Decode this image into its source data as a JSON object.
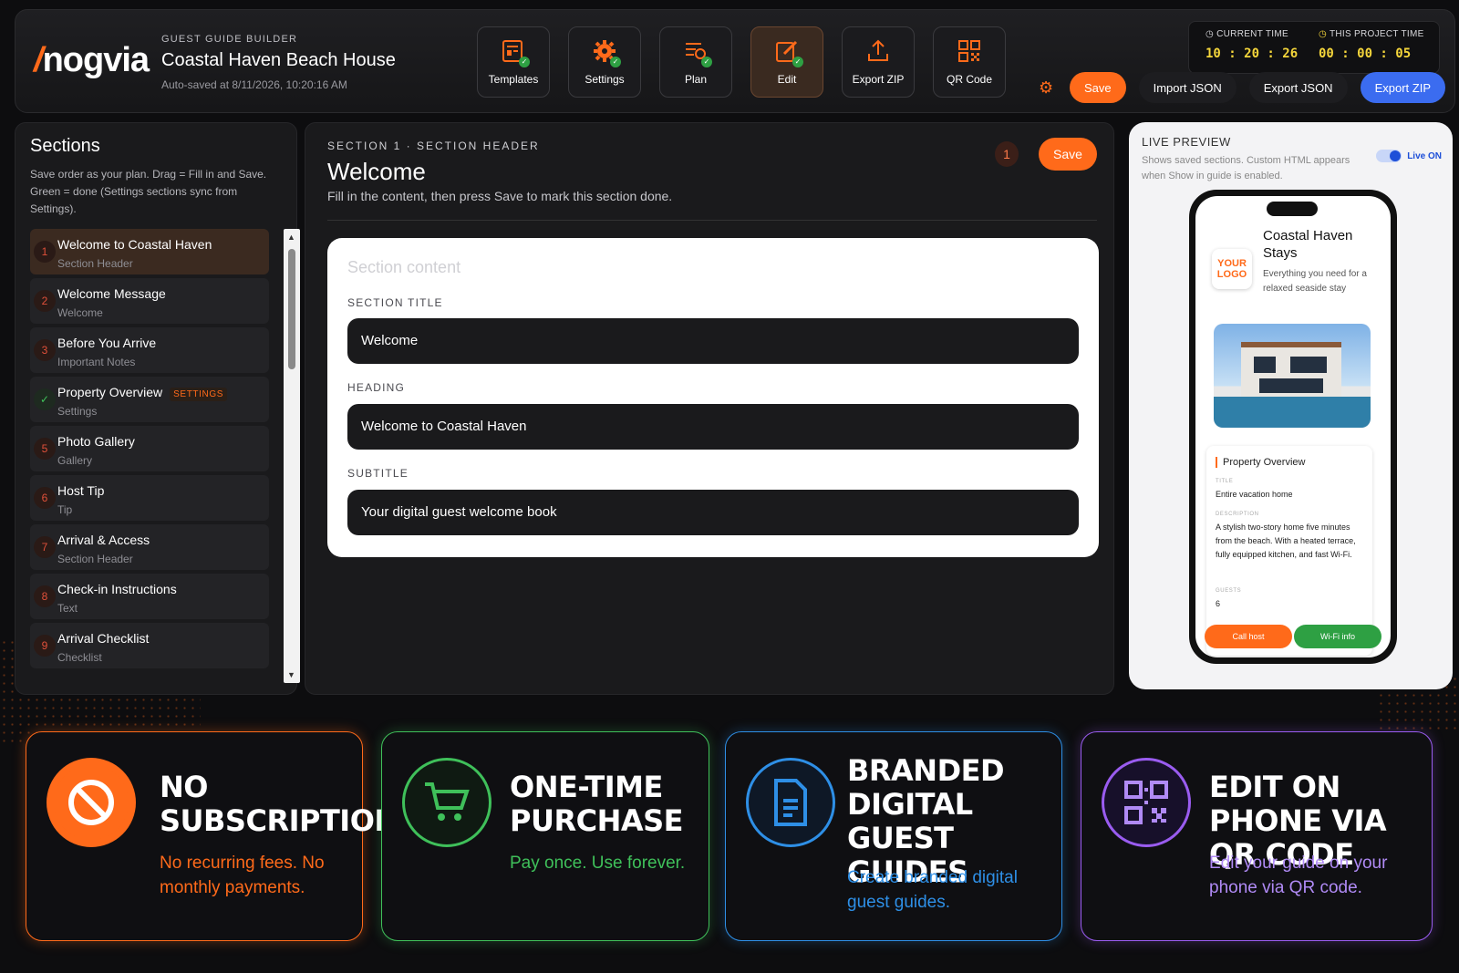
{
  "header": {
    "logo": "nogvia",
    "logo_slash": "/",
    "eyebrow": "GUEST GUIDE BUILDER",
    "project_title": "Coastal Haven Beach House",
    "autosave": "Auto-saved at 8/11/2026, 10:20:16 AM"
  },
  "toolbar": {
    "tools": [
      {
        "label": "Templates",
        "icon": "template-icon"
      },
      {
        "label": "Settings",
        "icon": "gear-icon"
      },
      {
        "label": "Plan",
        "icon": "plan-list-icon"
      },
      {
        "label": "Edit",
        "icon": "edit-icon"
      },
      {
        "label": "Export ZIP",
        "icon": "upload-icon"
      },
      {
        "label": "QR Code",
        "icon": "qr-code-icon"
      }
    ]
  },
  "clock": {
    "current_label": "CURRENT TIME",
    "current_value": "10 : 20 : 26",
    "project_label": "THIS PROJECT TIME",
    "project_value": "00 : 00 : 05"
  },
  "actions": {
    "save": "Save",
    "import_json": "Import JSON",
    "export_json": "Export JSON",
    "export_zip": "Export ZIP"
  },
  "sections": {
    "title": "Sections",
    "description": "Save order as your plan. Drag = Fill in and Save. Green = done (Settings sections sync from Settings).",
    "items": [
      {
        "num": "1",
        "title": "Welcome to Coastal Haven",
        "type": "Section Header"
      },
      {
        "num": "2",
        "title": "Welcome Message",
        "type": "Welcome"
      },
      {
        "num": "3",
        "title": "Before You Arrive",
        "type": "Important Notes"
      },
      {
        "num": "✓",
        "title": "Property Overview",
        "type": "Settings",
        "tag": "SETTINGS"
      },
      {
        "num": "5",
        "title": "Photo Gallery",
        "type": "Gallery"
      },
      {
        "num": "6",
        "title": "Host Tip",
        "type": "Tip"
      },
      {
        "num": "7",
        "title": "Arrival & Access",
        "type": "Section Header"
      },
      {
        "num": "8",
        "title": "Check-in Instructions",
        "type": "Text"
      },
      {
        "num": "9",
        "title": "Arrival Checklist",
        "type": "Checklist"
      }
    ]
  },
  "editor": {
    "eyebrow": "SECTION 1 · SECTION HEADER",
    "title": "Welcome",
    "hint": "Fill in the content, then press Save to mark this section done.",
    "count": "1",
    "save": "Save",
    "card_placeholder": "Section content",
    "fields": [
      {
        "label": "SECTION TITLE",
        "value": "Welcome"
      },
      {
        "label": "HEADING",
        "value": "Welcome to Coastal Haven"
      },
      {
        "label": "SUBTITLE",
        "value": "Your digital guest welcome book"
      }
    ]
  },
  "preview": {
    "title": "LIVE PREVIEW",
    "description": "Shows saved sections. Custom HTML appears when Show in guide is enabled.",
    "live_label": "Live ON",
    "phone": {
      "logo": "YOUR LOGO",
      "title": "Coastal Haven Stays",
      "subtitle": "Everything you need for a relaxed seaside stay",
      "overview_heading": "Property Overview",
      "title_label": "TITLE",
      "title_value": "Entire vacation home",
      "desc_label": "DESCRIPTION",
      "desc_value": "A stylish two-story home five minutes from the beach. With a heated terrace, fully equipped kitchen, and fast Wi-Fi.",
      "guests_label": "GUESTS",
      "guests_value": "6",
      "call_host": "Call host",
      "wifi_info": "Wi-Fi info"
    }
  },
  "features": [
    {
      "title": "NO SUBSCRIPTION",
      "sub": "No recurring fees. No monthly payments.",
      "color": "#ff6a1a",
      "icon": "no-sign-icon"
    },
    {
      "title": "ONE-TIME PURCHASE",
      "sub": "Pay once. Use forever.",
      "color": "#3fc05a",
      "icon": "cart-icon"
    },
    {
      "title": "BRANDED DIGITAL GUEST GUIDES",
      "sub": "Create branded digital guest guides.",
      "color": "#2e8fe6",
      "icon": "document-icon"
    },
    {
      "title": "EDIT ON PHONE VIA QR CODE",
      "sub": "Edit your guide on your phone via QR code.",
      "color": "#9a5cf0",
      "icon": "qr-code-icon"
    }
  ]
}
